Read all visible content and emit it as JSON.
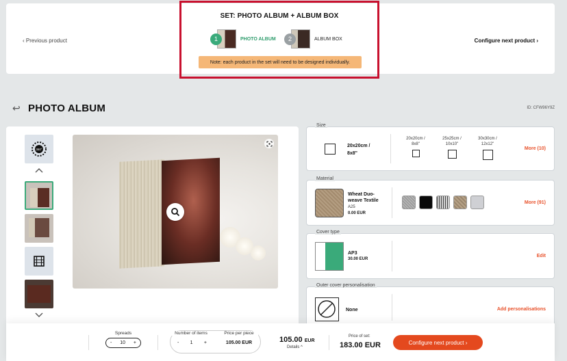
{
  "nav": {
    "prev_label": "‹ Previous product",
    "next_label": "Configure next product ›"
  },
  "set": {
    "title": "SET: PHOTO ALBUM + ALBUM BOX",
    "steps": [
      {
        "num": "1",
        "label": "PHOTO ALBUM",
        "active": true
      },
      {
        "num": "2",
        "label": "ALBUM BOX",
        "active": false
      }
    ],
    "note": "Note: each product in the set will need to be designed individually."
  },
  "product": {
    "title": "PHOTO ALBUM",
    "id": "ID: CFW96Y9Z"
  },
  "options": {
    "size": {
      "label": "Size",
      "selected": "20x20cm / 8x8\"",
      "choices": [
        {
          "line1": "20x20cm /",
          "line2": "8x8\""
        },
        {
          "line1": "25x25cm /",
          "line2": "10x10\""
        },
        {
          "line1": "30x30cm /",
          "line2": "12x12\""
        }
      ],
      "more": "More (10)"
    },
    "material": {
      "label": "Material",
      "name": "Wheat Duo-weave Textile",
      "code": "A25",
      "price": "0.00 EUR",
      "swatch_colors": [
        "#a9a9a9",
        "#0a0a0a",
        "#8e9296",
        "#a8957d",
        "#cfd0d4"
      ],
      "more": "More (91)"
    },
    "cover": {
      "label": "Cover type",
      "name": "AP3",
      "price": "30.00 EUR",
      "edit": "Edit"
    },
    "personalisation": {
      "label": "Outer cover personalisation",
      "value": "None",
      "add": "Add personalisations"
    }
  },
  "bottom": {
    "spreads_label": "Spreads",
    "spreads_value": "10",
    "items_label": "Number of items",
    "items_value": "1",
    "ppp_label": "Price per piece",
    "ppp_value": "105.00 EUR",
    "total_value": "105.00",
    "total_currency": "EUR",
    "details": "Details ^",
    "set_price_label": "Price of set:",
    "set_price": "183.00 EUR",
    "cta": "Configure next product ›"
  },
  "colors": {
    "accent": "#e4491e",
    "green": "#3aaa7a",
    "highlight_border": "#c8102e",
    "note_bg": "#f5b777"
  }
}
